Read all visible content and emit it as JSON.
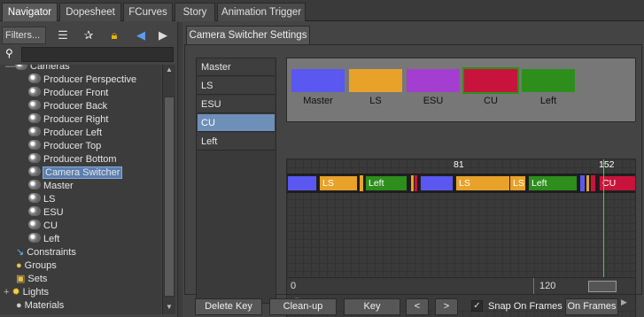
{
  "tabs": [
    {
      "label": "Navigator"
    },
    {
      "label": "Dopesheet"
    },
    {
      "label": "FCurves"
    },
    {
      "label": "Story"
    },
    {
      "label": "Animation Trigger"
    }
  ],
  "navigator": {
    "filters_label": "Filters...",
    "search": {
      "value": "",
      "placeholder": ""
    },
    "tree": [
      {
        "label": "Cameras"
      },
      {
        "label": "Producer Perspective"
      },
      {
        "label": "Producer Front"
      },
      {
        "label": "Producer Back"
      },
      {
        "label": "Producer Right"
      },
      {
        "label": "Producer Left"
      },
      {
        "label": "Producer Top"
      },
      {
        "label": "Producer Bottom"
      },
      {
        "label": "Camera Switcher"
      },
      {
        "label": "Master"
      },
      {
        "label": "LS"
      },
      {
        "label": "ESU"
      },
      {
        "label": "CU"
      },
      {
        "label": "Left"
      },
      {
        "label": "Constraints"
      },
      {
        "label": "Groups"
      },
      {
        "label": "Sets"
      },
      {
        "label": "Lights"
      },
      {
        "label": "Materials"
      }
    ]
  },
  "settings_tab": "Camera Switcher Settings",
  "camera_list": [
    {
      "label": "Master"
    },
    {
      "label": "LS"
    },
    {
      "label": "ESU"
    },
    {
      "label": "CU"
    },
    {
      "label": "Left"
    }
  ],
  "swatches": [
    {
      "label": "Master",
      "color": "#5a58f0"
    },
    {
      "label": "LS",
      "color": "#e8a22a"
    },
    {
      "label": "ESU",
      "color": "#a43ed0"
    },
    {
      "label": "CU",
      "color": "#c8143c"
    },
    {
      "label": "Left",
      "color": "#2d8e1c"
    }
  ],
  "timeline": {
    "top_markers": [
      "81",
      "152"
    ],
    "segments": [
      {
        "label": "",
        "color": "#5a58f0"
      },
      {
        "label": "LS",
        "color": "#e8a22a"
      },
      {
        "label": "Left",
        "color": "#2d8e1c"
      },
      {
        "label": "",
        "color": "#5a58f0"
      },
      {
        "label": "LS",
        "color": "#e8a22a"
      },
      {
        "label": "LS",
        "color": "#e8a22a"
      },
      {
        "label": "Left",
        "color": "#2d8e1c"
      },
      {
        "label": "CU",
        "color": "#c8143c"
      }
    ],
    "ruler_start": "0",
    "ruler_mark": "120"
  },
  "bottom": {
    "delete_key": "Delete Key",
    "cleanup": "Clean-up",
    "key": "Key",
    "prev": "<",
    "next": ">",
    "snap_label": "Snap On Frames",
    "snap_checked": "✓",
    "snap_mode": "On Frames"
  }
}
